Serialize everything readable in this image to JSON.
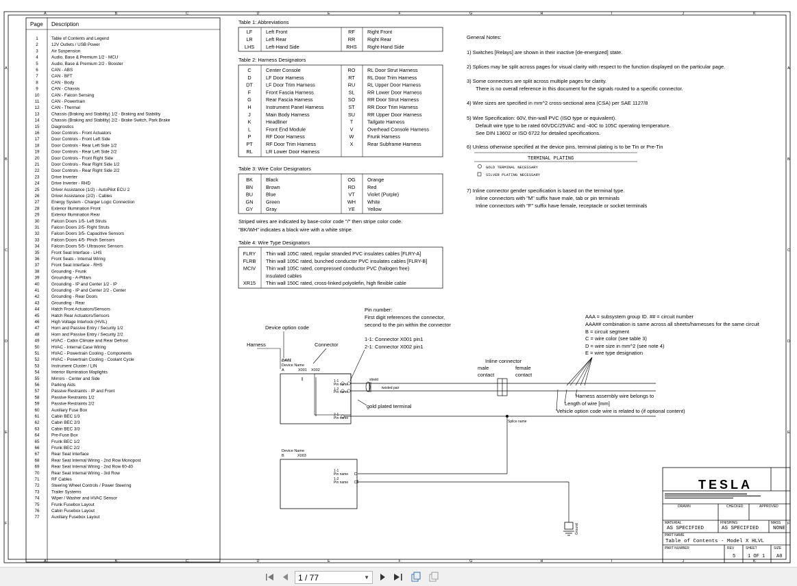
{
  "ruler": {
    "cols": [
      "A",
      "B",
      "C",
      "D",
      "E",
      "F",
      "G",
      "H",
      "I",
      "J",
      "K"
    ],
    "rows": [
      "A",
      "B",
      "C",
      "D",
      "E",
      "F"
    ]
  },
  "toc": {
    "header_page": "Page",
    "header_desc": "Description",
    "rows": [
      [
        "1",
        "Table of Contents and Legend"
      ],
      [
        "2",
        "12V Outlets / USB Power"
      ],
      [
        "3",
        "Air Suspension"
      ],
      [
        "4",
        "Audio, Base & Premium 1/2 - MCU"
      ],
      [
        "5",
        "Audio, Base & Premium 2/2 - Booster"
      ],
      [
        "6",
        "CAN - ABS"
      ],
      [
        "7",
        "CAN - BFT"
      ],
      [
        "8",
        "CAN - Body"
      ],
      [
        "9",
        "CAN - Chassis"
      ],
      [
        "10",
        "CAN - Falcon Sensing"
      ],
      [
        "11",
        "CAN - Powertrain"
      ],
      [
        "12",
        "CAN - Thermal"
      ],
      [
        "13",
        "Chassis (Braking and Stability) 1/2 - Braking and Stability"
      ],
      [
        "14",
        "Chassis (Braking and Stability) 2/2 - Brake Switch, Park Brake"
      ],
      [
        "15",
        "Diagnostics"
      ],
      [
        "16",
        "Door Controls - Front Actuators"
      ],
      [
        "17",
        "Door Controls - Front Left Side"
      ],
      [
        "18",
        "Door Controls - Rear Left Side 1/2"
      ],
      [
        "19",
        "Door Controls - Rear Left Side 2/2"
      ],
      [
        "20",
        "Door Controls - Front Right Side"
      ],
      [
        "21",
        "Door Controls - Rear Right Side 1/2"
      ],
      [
        "22",
        "Door Controls - Rear Right Side 2/2"
      ],
      [
        "23",
        "Drive Inverter"
      ],
      [
        "24",
        "Drive Inverter - RHD"
      ],
      [
        "25",
        "Driver Assistance (1/2) - AutoPilot ECU 2"
      ],
      [
        "26",
        "Driver Assistance (2/2) - Cables"
      ],
      [
        "27",
        "Energy System - Charger Logic Connection"
      ],
      [
        "28",
        "Exterior Illumination Front"
      ],
      [
        "29",
        "Exterior Illumination Rear"
      ],
      [
        "30",
        "Falcon Doors 1/5- Left Struts"
      ],
      [
        "31",
        "Falcon Doors 2/5- Right Struts"
      ],
      [
        "32",
        "Falcon Doors 3/5- Capacitive Sensors"
      ],
      [
        "33",
        "Falcon Doors 4/5- Pinch Sensors"
      ],
      [
        "34",
        "Falcon Doors 5/5- Ultrasonic Sensors"
      ],
      [
        "35",
        "Front Seat Interface - LHS"
      ],
      [
        "36",
        "Front Seats - Internal Wiring"
      ],
      [
        "37",
        "Front Seat Interface - RHS"
      ],
      [
        "38",
        "Grounding - Frunk"
      ],
      [
        "39",
        "Grounding - A-Pillars"
      ],
      [
        "40",
        "Grounding - IP and Center 1/2 - IP"
      ],
      [
        "41",
        "Grounding - IP and Center 2/2 - Center"
      ],
      [
        "42",
        "Grounding - Rear Doors"
      ],
      [
        "43",
        "Grounding - Rear"
      ],
      [
        "44",
        "Hatch Front Actuators/Sensors"
      ],
      [
        "45",
        "Hatch Rear Actuators/Sensors"
      ],
      [
        "46",
        "High Voltage Interlock (HVIL)"
      ],
      [
        "47",
        "Horn and Passive Entry / Security 1/2"
      ],
      [
        "48",
        "Horn and Passive Entry / Security 2/2"
      ],
      [
        "49",
        "HVAC - Cabin Climate and Rear Defrost"
      ],
      [
        "50",
        "HVAC - Internal Case Wiring"
      ],
      [
        "51",
        "HVAC - Powertrain Cooling - Components"
      ],
      [
        "52",
        "HVAC - Powertrain Cooling - Coolant Cycle"
      ],
      [
        "53",
        "Instrument Cluster / LIN"
      ],
      [
        "54",
        "Interior Illumination Maplights"
      ],
      [
        "55",
        "Mirrors - Center and Side"
      ],
      [
        "56",
        "Parking Aids"
      ],
      [
        "57",
        "Passive Restraints - IP and Front"
      ],
      [
        "58",
        "Passive Restraints 1/2"
      ],
      [
        "59",
        "Passive Restraints 2/2"
      ],
      [
        "60",
        "Auxiliary Fuse Box"
      ],
      [
        "61",
        "Cabin BEC 1/3"
      ],
      [
        "62",
        "Cabin BEC 2/3"
      ],
      [
        "63",
        "Cabin BEC 3/3"
      ],
      [
        "64",
        "Pre-Fuse Box"
      ],
      [
        "65",
        "Frunk BEC 1/2"
      ],
      [
        "66",
        "Frunk BEC 2/2"
      ],
      [
        "67",
        "Rear Seat Interface"
      ],
      [
        "68",
        "Rear Seat Internal Wiring - 2nd Row Monopost"
      ],
      [
        "69",
        "Rear Seat Internal Wiring - 2nd Row 60-40"
      ],
      [
        "70",
        "Rear Seat Internal Wiring - 3rd Row"
      ],
      [
        "71",
        "RF Cables"
      ],
      [
        "72",
        "Steering Wheel Controls / Power Steering"
      ],
      [
        "73",
        "Trailer Systems"
      ],
      [
        "74",
        "Wiper / Washer and HVAC Sensor"
      ],
      [
        "75",
        "Frunk Fusebox Layout"
      ],
      [
        "76",
        "Cabin Fusebox Layout"
      ],
      [
        "77",
        "Auxiliary Fusebox Layout"
      ]
    ]
  },
  "table1": {
    "title": "Table 1: Abbreviations",
    "left": [
      [
        "LF",
        "Left Front"
      ],
      [
        "LR",
        "Left Rear"
      ],
      [
        "LHS",
        "Left-Hand Side"
      ]
    ],
    "right": [
      [
        "RF",
        "Right Front"
      ],
      [
        "RR",
        "Right Rear"
      ],
      [
        "RHS",
        "Right-Hand Side"
      ]
    ]
  },
  "table2": {
    "title": "Table 2: Harness Designators",
    "left": [
      [
        "C",
        "Center Console"
      ],
      [
        "D",
        "LF Door Harness"
      ],
      [
        "DT",
        "LF Door Trim Harness"
      ],
      [
        "F",
        "Front Fascia Harness"
      ],
      [
        "G",
        "Rear Fascia Harness"
      ],
      [
        "H",
        "Instrument Panel Harness"
      ],
      [
        "J",
        "Main Body Harness"
      ],
      [
        "K",
        "Headliner"
      ],
      [
        "L",
        "Front End Module"
      ],
      [
        "P",
        "RF Door Harness"
      ],
      [
        "PT",
        "RF Door Trim Harness"
      ],
      [
        "RL",
        "LR Lower Door Harness"
      ]
    ],
    "right": [
      [
        "RO",
        "RL Door Strut Harness"
      ],
      [
        "RT",
        "RL Door Trim Harness"
      ],
      [
        "RU",
        "RL Upper Door Harness"
      ],
      [
        "SL",
        "RR Lower Door Harness"
      ],
      [
        "SO",
        "RR Door Strut Harness"
      ],
      [
        "ST",
        "RR Door Trim Harness"
      ],
      [
        "SU",
        "RR Upper Door Harness"
      ],
      [
        "T",
        "Tailgate Harness"
      ],
      [
        "V",
        "Overhead Console Harness"
      ],
      [
        "W",
        "Frunk Harness"
      ],
      [
        "X",
        "Rear Subframe Harness"
      ]
    ]
  },
  "table3": {
    "title": "Table 3: Wire Color Designators",
    "left": [
      [
        "BK",
        "Black"
      ],
      [
        "BN",
        "Brown"
      ],
      [
        "BU",
        "Blue"
      ],
      [
        "GN",
        "Green"
      ],
      [
        "GY",
        "Gray"
      ]
    ],
    "right": [
      [
        "OG",
        "Orange"
      ],
      [
        "RD",
        "Red"
      ],
      [
        "VT",
        "Violet (Purple)"
      ],
      [
        "WH",
        "White"
      ],
      [
        "YE",
        "Yellow"
      ]
    ],
    "note1": "Striped wires are indicated by base-color code \"/\" then stripe color code.",
    "note2": "\"BK/WH\" indicates a black wire with a white stripe."
  },
  "table4": {
    "title": "Table 4: Wire Type Designators",
    "rows": [
      [
        "FLRY",
        "Thin wall 105C rated, regular stranded PVC insulates cables [FLRY-A]"
      ],
      [
        "FLRB",
        "Thin wall 105C rated, bunched conductor PVC insulates cables [FLRY-B]"
      ],
      [
        "MCIV",
        "Thin wall 105C rated, compressed conductor PVC (halogen free)"
      ],
      [
        "",
        "insulated cables"
      ],
      [
        "XR15",
        "Thin wall 150C rated, cross-linked polyolefin, high flexible cable"
      ]
    ]
  },
  "notes": {
    "title": "General Notes:",
    "n1": "1) Switches [Relays] are shown in their inactive [de-energized] state.",
    "n2": "2) Splices may be split across pages for visual clarity with respect to the function displayed on the particular page.",
    "n3a": "3) Some connectors are split across multiple pages for clarity.",
    "n3b": "There is no overall reference in this document for the signals routed to a specific connector.",
    "n4": "4) Wire sizes are specified in mm^2 cross-sectional area (CSA) per SAE 1127/8",
    "n5a": "5) Wire Specification: 60V, thin-wall PVC (ISO type or equivalent).",
    "n5b": "Default wire type to be rated 60VDC/25VAC and -40C to 105C operating temperature.",
    "n5c": "See DIN 13602 or ISO 6722 for detailed specifications.",
    "n6": "6) Unless otherwise specified at the device pins, terminal plating is to be Tin or Pre-Tin",
    "plating_title": "TERMINAL PLATING",
    "gold": "GOLD TERMINAL NECESSARY",
    "silver": "SILVER PLATING NECESSARY",
    "n7a": "7) Inline connector gender specification is based on the terminal type.",
    "n7b": "Inline connectors with \"M\" suffix have male, tab or pin terminals",
    "n7c": "Inline connectors with \"F\" suffix have female, receptacle or socket terminals"
  },
  "legend": {
    "pin1": "Pin number:",
    "pin2": "First digit references the connector,",
    "pin3": "second to the pin within the connector",
    "pin4": "1-1: Connector X001 pin1",
    "pin5": "2-1: Connector X002 pin1",
    "device_option": "Device option code",
    "harness": "Harness",
    "connector": "Connector",
    "da01": "DA01",
    "device_name": "Device Name",
    "dev_a": "A",
    "x001": "X001",
    "x002": "X002",
    "inline": "Inline connector",
    "male": "male",
    "male2": "contact",
    "female": "female",
    "female2": "contact",
    "gold_plated": "gold plated terminal",
    "aaa1": "AAA = subsystem group ID. ## = circuit number",
    "aaa2": "AAA## combination is same across all sheets/harnesses for the same circuit",
    "aaa3": "B = circuit segment",
    "aaa4": "C = wire color (see table 3)",
    "aaa5": "D = wire size in mm^2 (see note 4)",
    "aaa6": "E = wire type designation",
    "belongs": "Harness assembly wire belongs to",
    "length": "Length of wire [mm]",
    "vehicle": "Vehicle option code wire is related to (if optional content)",
    "device_name2": "Device Name",
    "dev_b": "B",
    "x003": "X003",
    "shield": "shield",
    "twisted": "twisted pair",
    "splice": "Splice name",
    "pin_name": "Pin name",
    "p11": "1-1",
    "p12": "1-2",
    "p21": "2-1",
    "ground": "Ground"
  },
  "title_block": {
    "logo": "TESLA",
    "drawn": "DRAWN",
    "checked": "CHECKED",
    "approved": "APPROVED",
    "material_label": "MATERIAL",
    "material": "AS SPECIFIED",
    "finishing_label": "FINISHING",
    "finishing": "AS SPECIFIED",
    "mass_label": "MASS",
    "mass": "NONE",
    "part_name_label": "PART NAME",
    "part_name": "Table of Contents - Model X HLVL",
    "part_number_label": "PART NUMBER",
    "rev_label": "REV",
    "rev": "5",
    "sheet_label": "SHEET",
    "sheet": "1 OF 1",
    "size_label": "SIZE",
    "size": "A0"
  },
  "toolbar": {
    "page_indicator": "1 / 77"
  }
}
